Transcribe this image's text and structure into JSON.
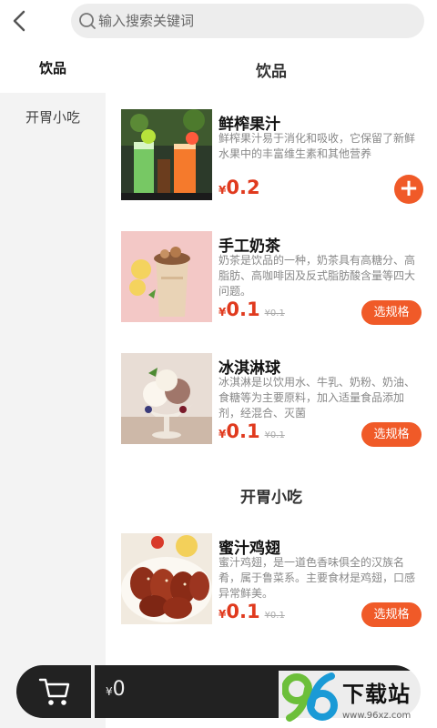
{
  "header": {
    "back_icon": "chevron-left-icon",
    "search_placeholder": "输入搜索关键词"
  },
  "sidebar": {
    "items": [
      {
        "label": "饮品",
        "active": true
      },
      {
        "label": "开胃小吃",
        "active": false
      }
    ]
  },
  "sections": [
    {
      "title": "饮品",
      "items": [
        {
          "name": "鲜榨果汁",
          "desc": "鲜榨果汁易于消化和吸收，它保留了新鲜水果中的丰富维生素和其他营养",
          "yen": "¥",
          "price": "0.2",
          "old_price": "",
          "action": "+",
          "action_type": "add"
        },
        {
          "name": "手工奶茶",
          "desc": "奶茶是饮品的一种，奶茶具有高糖分、高脂肪、高咖啡因及反式脂肪酸含量等四大问题。",
          "yen": "¥",
          "price": "0.1",
          "old_price": "¥0.1",
          "action": "选规格",
          "action_type": "spec"
        },
        {
          "name": "冰淇淋球",
          "desc": "冰淇淋是以饮用水、牛乳、奶粉、奶油、食糖等为主要原料，加入适量食品添加剂，经混合、灭菌",
          "yen": "¥",
          "price": "0.1",
          "old_price": "¥0.1",
          "action": "选规格",
          "action_type": "spec"
        }
      ]
    },
    {
      "title": "开胃小吃",
      "items": [
        {
          "name": "蜜汁鸡翅",
          "desc": "蜜汁鸡翅，是一道色香味俱全的汉族名肴，属于鲁菜系。主要食材是鸡翅，口感异常鲜美。",
          "yen": "¥",
          "price": "0.1",
          "old_price": "¥0.1",
          "action": "选规格",
          "action_type": "spec"
        }
      ]
    }
  ],
  "cart": {
    "icon": "cart-icon",
    "currency": "¥",
    "total": "0"
  },
  "watermark": {
    "logo": "96",
    "text": "下载站",
    "url": "www.96xz.com"
  },
  "colors": {
    "accent": "#f05a28",
    "price": "#e03a1e",
    "sidebar_bg": "#f3f3f3",
    "cart_bg": "#222222"
  }
}
